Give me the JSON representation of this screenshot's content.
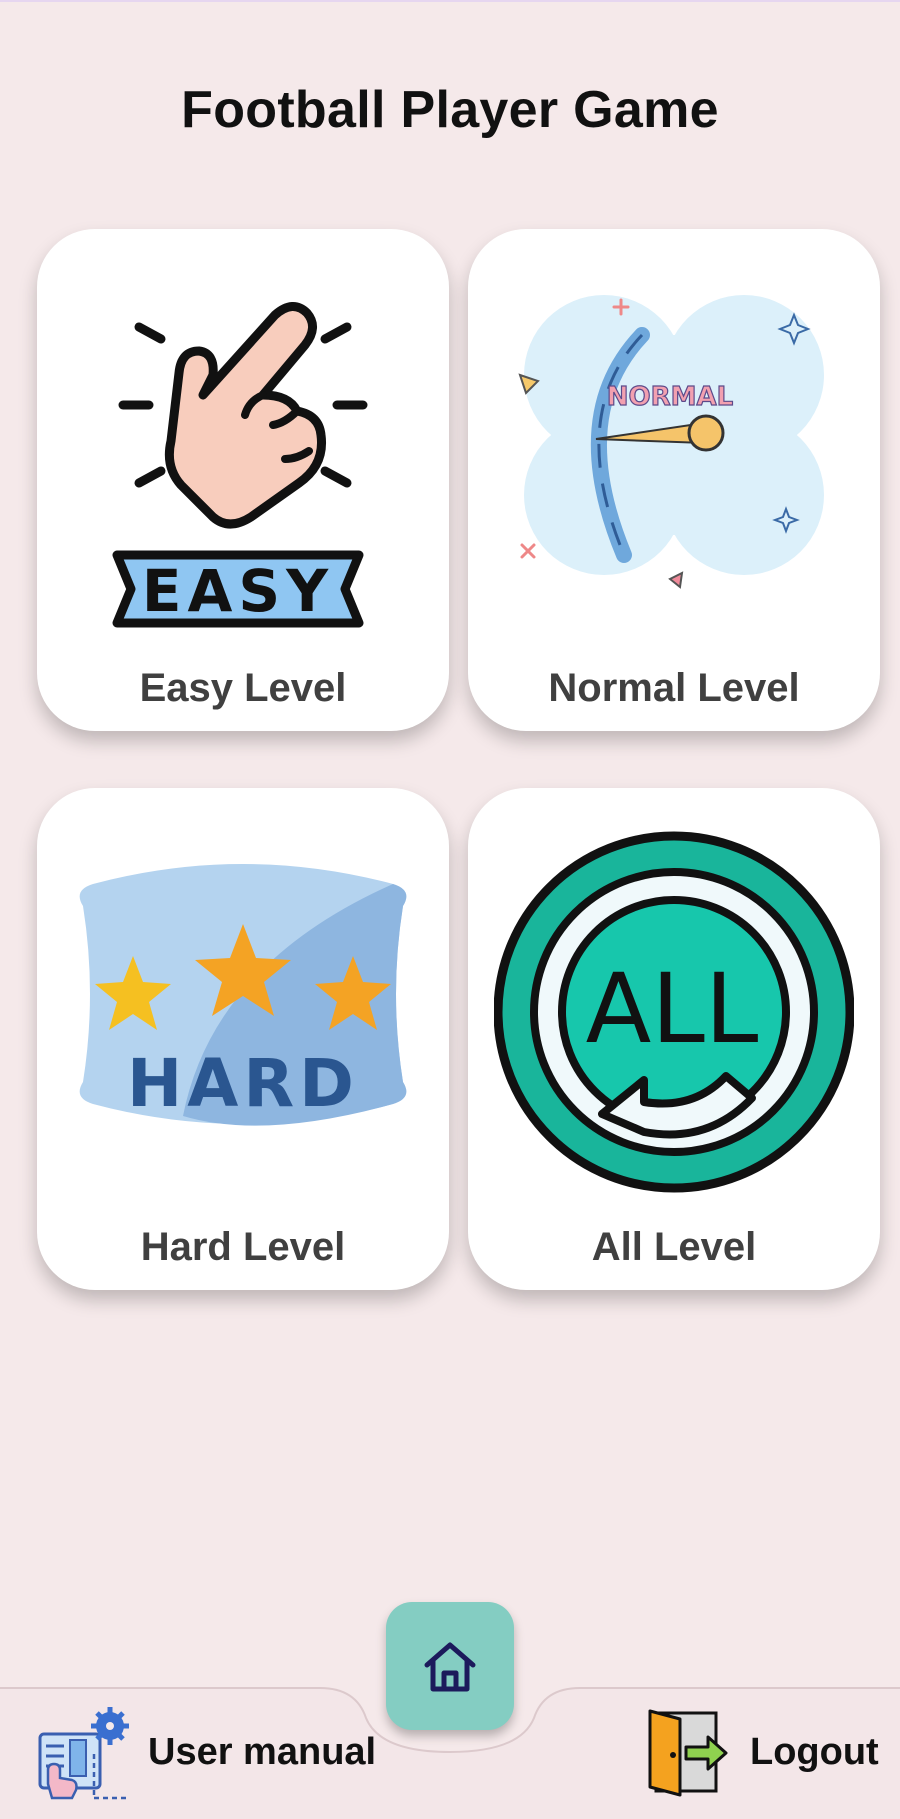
{
  "page": {
    "title": "Football Player Game"
  },
  "levels": [
    {
      "label": "Easy Level",
      "icon": "easy-hand-icon",
      "icon_text": "EASY"
    },
    {
      "label": "Normal Level",
      "icon": "normal-gauge-icon",
      "icon_text": "NORMAL"
    },
    {
      "label": "Hard Level",
      "icon": "hard-stars-icon",
      "icon_text": "HARD"
    },
    {
      "label": "All Level",
      "icon": "all-cycle-icon",
      "icon_text": "ALL"
    }
  ],
  "bottom_nav": {
    "user_manual_label": "User manual",
    "user_manual_icon": "manual-icon",
    "home_icon": "home-icon",
    "logout_label": "Logout",
    "logout_icon": "exit-door-icon"
  },
  "colors": {
    "background": "#f5e9ea",
    "card": "#ffffff",
    "home_button": "#84cdc2",
    "title_text": "#111111",
    "label_text": "#404040"
  }
}
